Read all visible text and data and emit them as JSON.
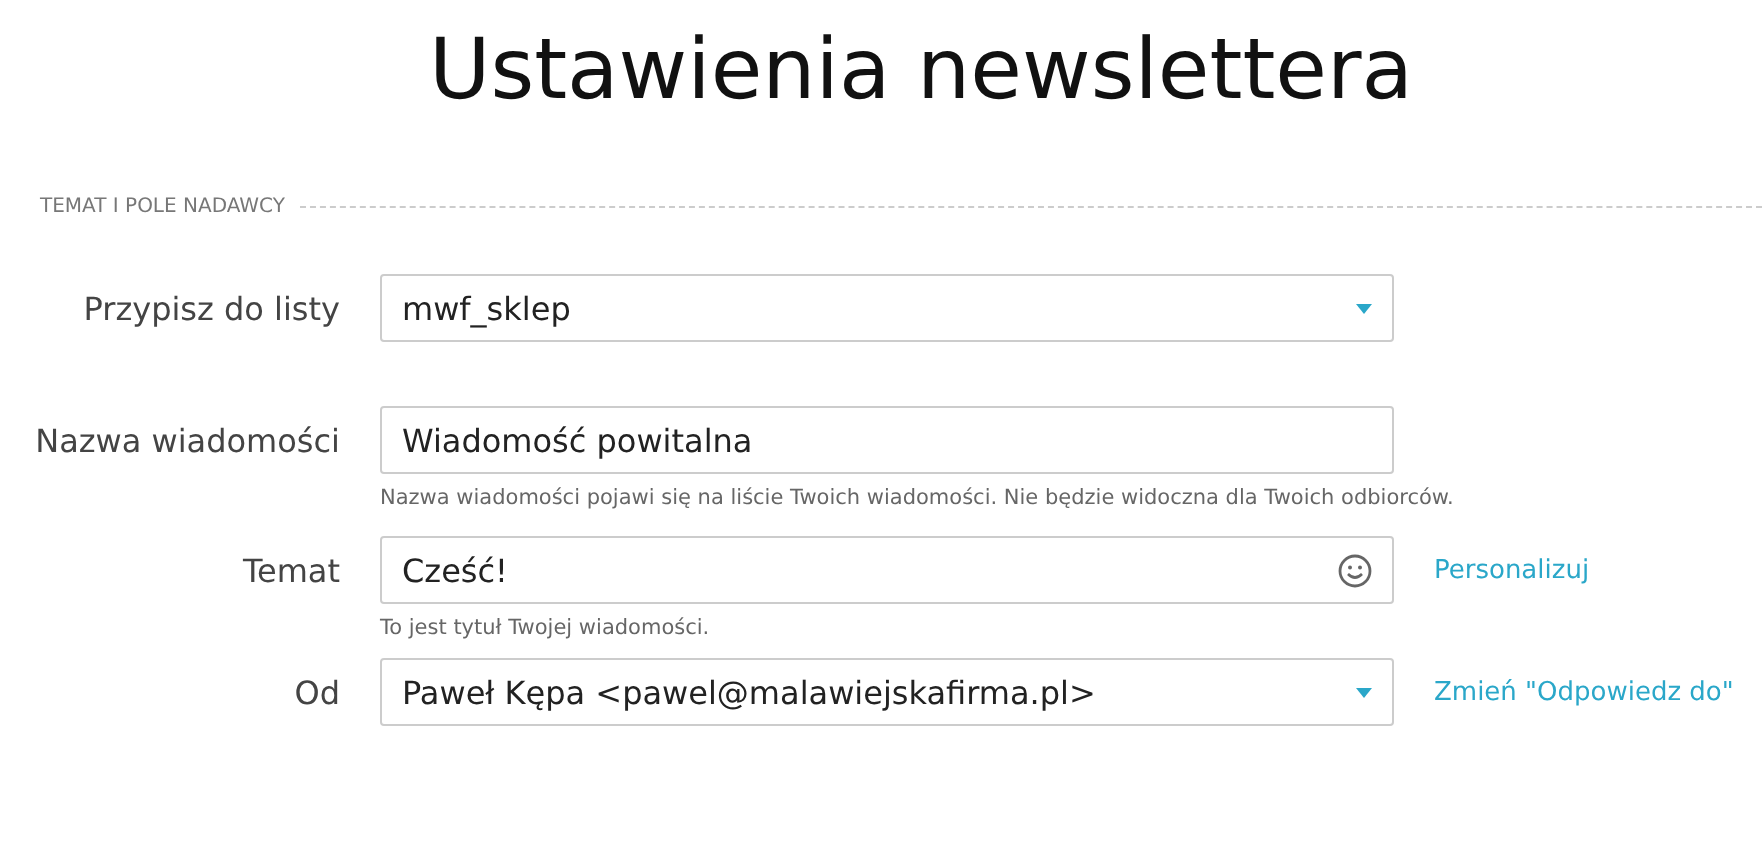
{
  "title": "Ustawienia newslettera",
  "section": {
    "heading": "TEMAT I POLE NADAWCY"
  },
  "rows": [
    {
      "label": "Przypisz do listy",
      "kind": "select",
      "value": "mwf_sklep"
    },
    {
      "label": "Nazwa wiadomości",
      "kind": "text",
      "value": "Wiadomość powitalna",
      "hint": "Nazwa wiadomości pojawi się na liście Twoich wiadomości. Nie będzie widoczna dla Twoich odbiorców."
    },
    {
      "label": "Temat",
      "kind": "emoji-text",
      "value": "Cześć!",
      "hint": "To jest tytuł Twojej wiadomości.",
      "link": "Personalizuj"
    },
    {
      "label": "Od",
      "kind": "select",
      "value": "Paweł Kępa <pawel@malawiejskafirma.pl>",
      "link": "Zmień \"Odpowiedz do\""
    }
  ]
}
